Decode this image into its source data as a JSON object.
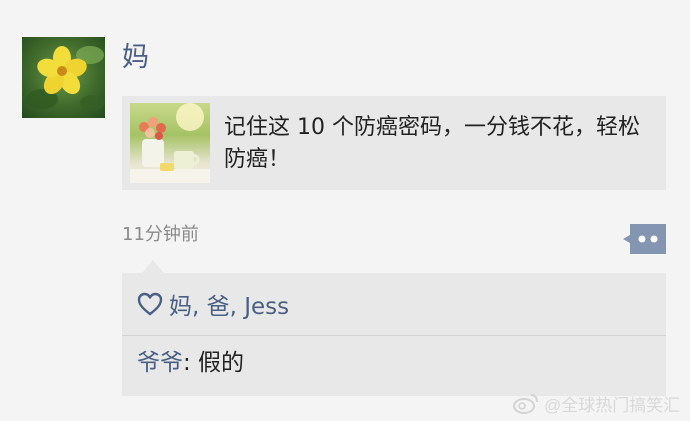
{
  "post": {
    "author": "妈",
    "avatar_icon": "yellow-flower-icon",
    "link": {
      "title": "记住这 10 个防癌密码，一分钱不花，轻松防癌！",
      "thumbnail_icon": "flowers-teacup-icon"
    },
    "timestamp": "11分钟前",
    "comment_button_icon": "more-dots-icon"
  },
  "interactions": {
    "like_icon": "heart-icon",
    "likers": "妈, 爸, Jess",
    "comments": [
      {
        "author": "爷爷",
        "text": ": 假的"
      }
    ]
  },
  "watermark": {
    "icon": "weibo-logo-icon",
    "text": "@全球热门搞笑汇"
  },
  "colors": {
    "name_blue": "#4a5f86",
    "panel_gray": "#e8e8e8",
    "background": "#f4f4f4"
  }
}
